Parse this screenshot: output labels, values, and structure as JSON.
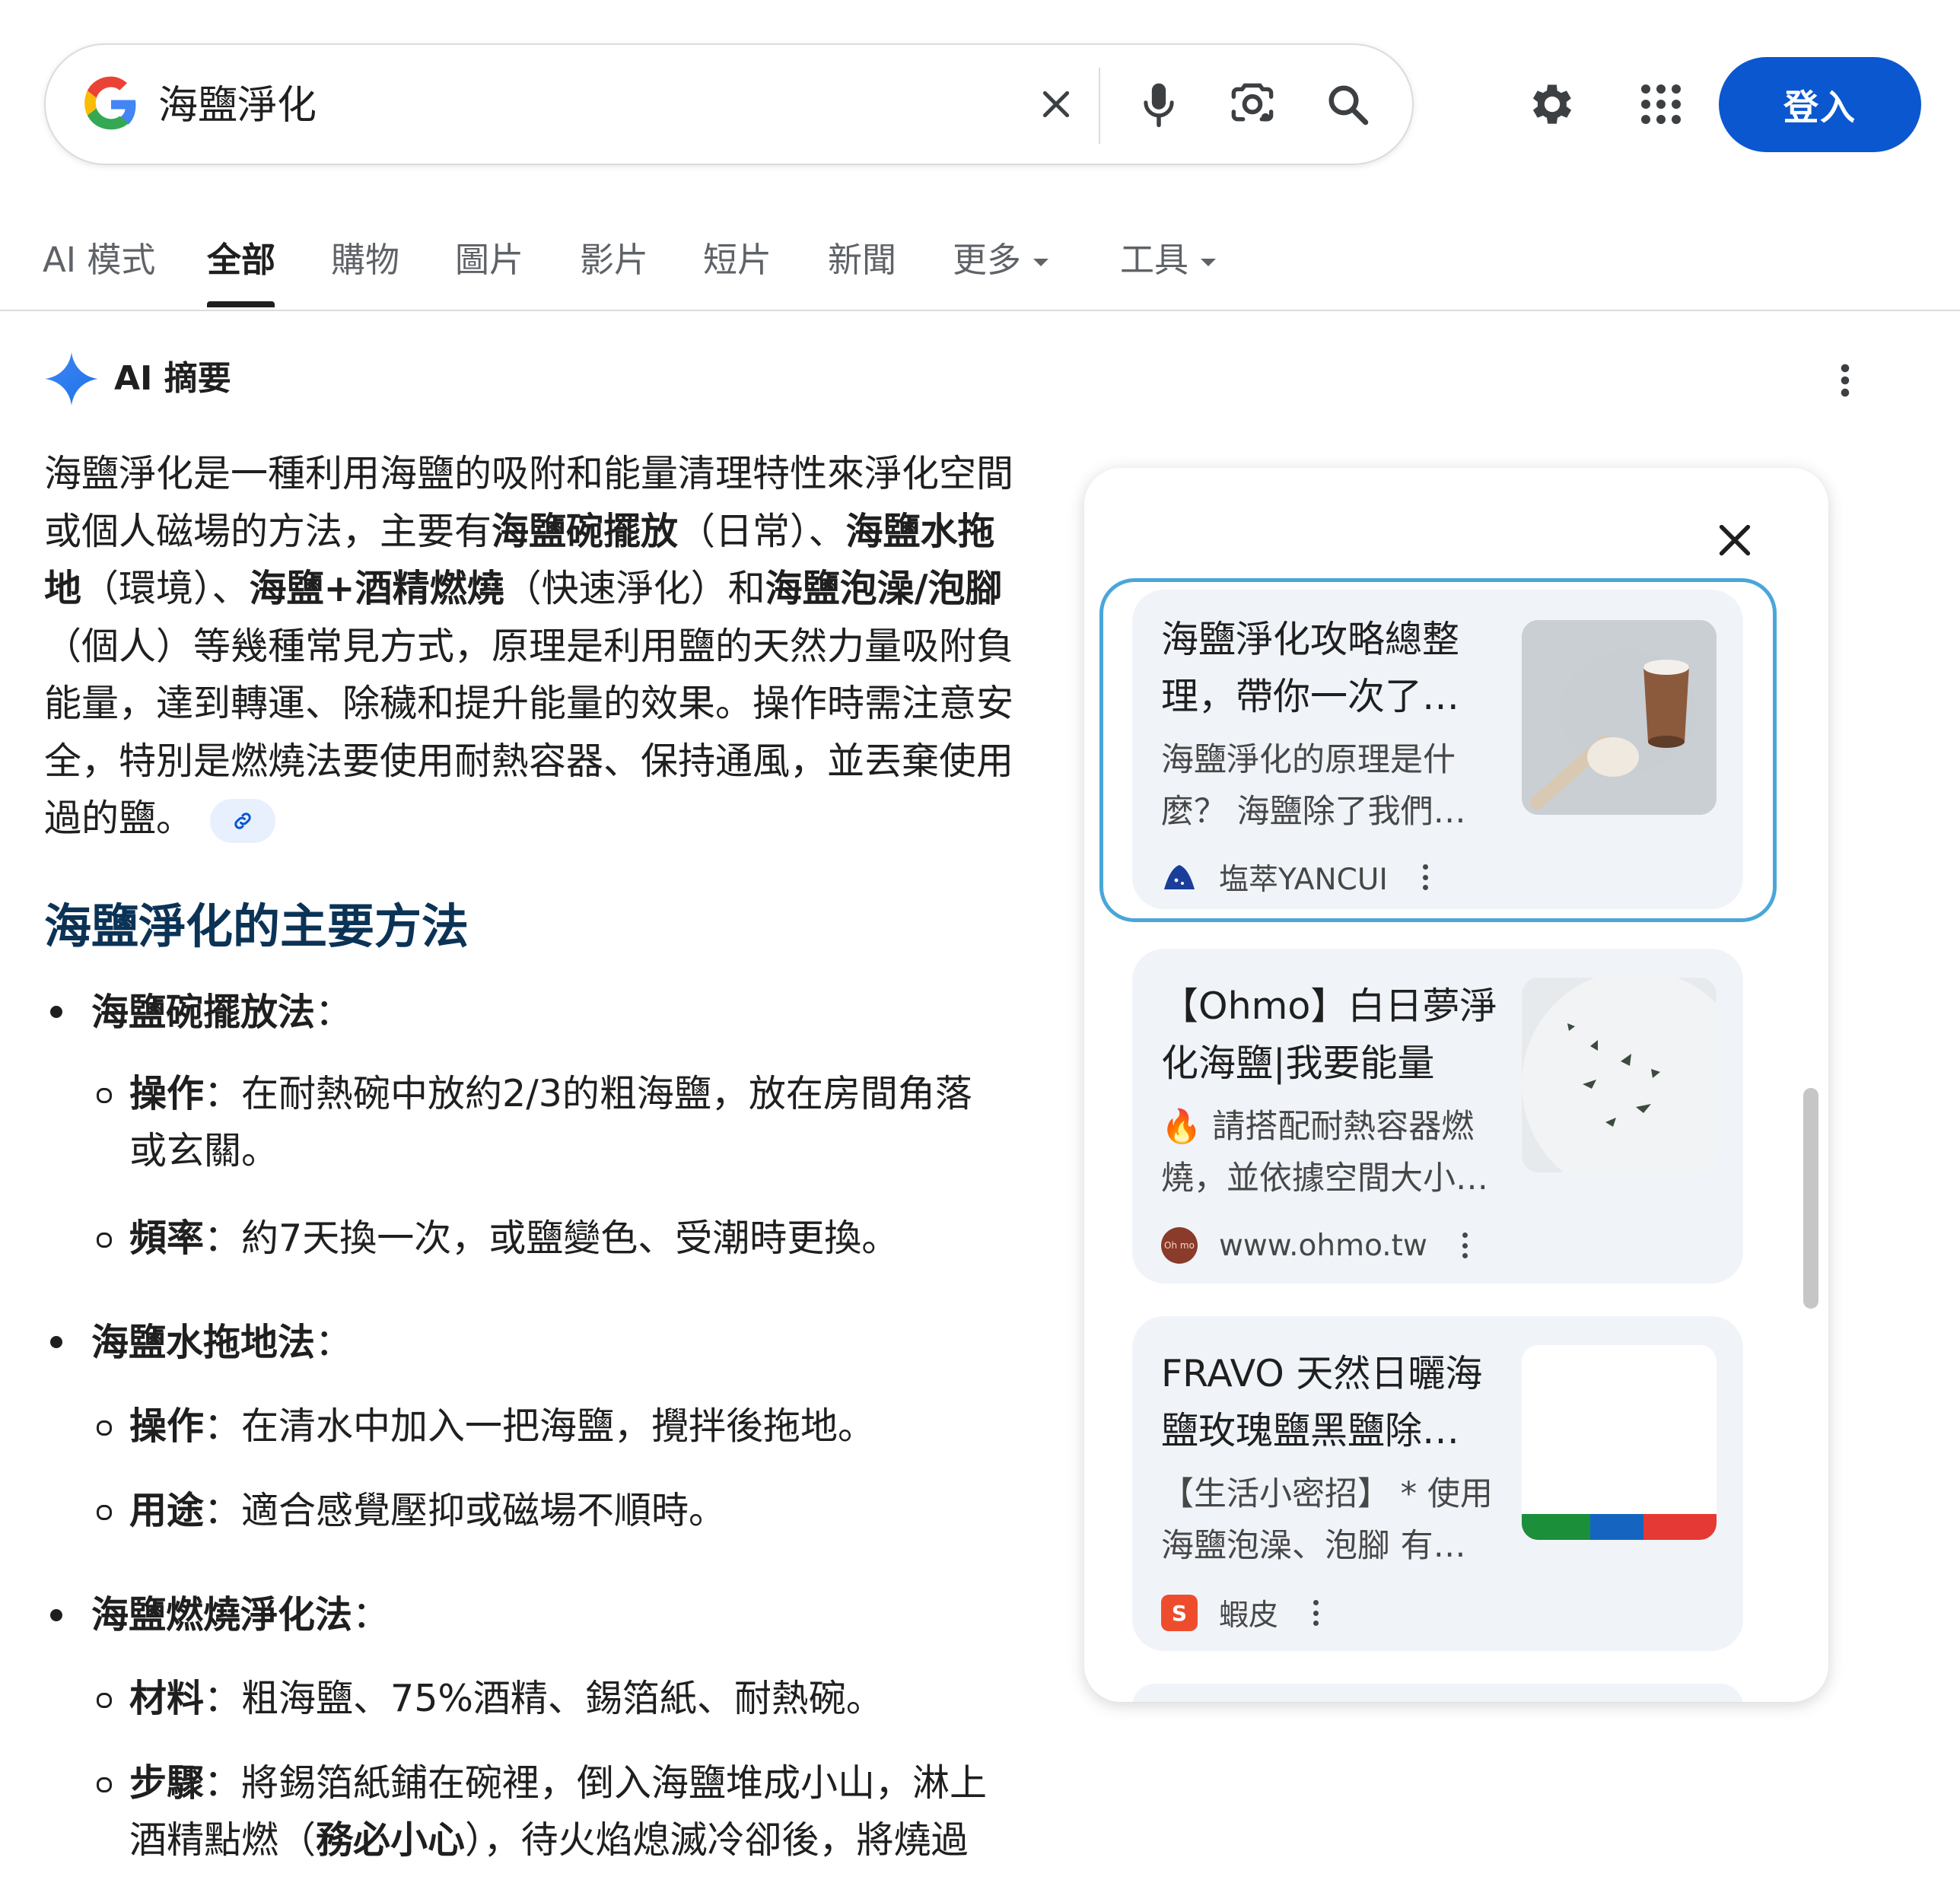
{
  "search": {
    "query": "海鹽淨化"
  },
  "header": {
    "signin_label": "登入"
  },
  "tabs": [
    {
      "label": "AI 模式"
    },
    {
      "label": "全部"
    },
    {
      "label": "購物"
    },
    {
      "label": "圖片"
    },
    {
      "label": "影片"
    },
    {
      "label": "短片"
    },
    {
      "label": "新聞"
    },
    {
      "label": "更多"
    },
    {
      "label": "工具"
    }
  ],
  "ai_overview": {
    "label": "AI 摘要",
    "summary": {
      "p1": "海鹽淨化是一種利用海鹽的吸附和能量清理特性來淨化空間或個人磁場的方法，主要有",
      "b1": "海鹽碗擺放",
      "p2": "（日常）、",
      "b2": "海鹽水拖地",
      "p3": "（環境）、",
      "b3": "海鹽+酒精燃燒",
      "p4": "（快速淨化）和",
      "b4": "海鹽泡澡/泡腳",
      "p5": "（個人）等幾種常見方式，原理是利用鹽的天然力量吸附負能量，達到轉運、除穢和提升能量的效果。操作時需注意安全，特別是燃燒法要使用耐熱容器、保持通風，並丟棄使用過的鹽。"
    },
    "section_heading": "海鹽淨化的主要方法",
    "methods": [
      {
        "title": "海鹽碗擺放法",
        "colon": "：",
        "items": [
          {
            "label": "操作",
            "text": "：在耐熱碗中放約2/3的粗海鹽，放在房間角落或玄關。"
          },
          {
            "label": "頻率",
            "text": "：約7天換一次，或鹽變色、受潮時更換。"
          }
        ]
      },
      {
        "title": "海鹽水拖地法",
        "colon": "：",
        "items": [
          {
            "label": "操作",
            "text": "：在清水中加入一把海鹽，攪拌後拖地。"
          },
          {
            "label": "用途",
            "text": "：適合感覺壓抑或磁場不順時。"
          }
        ]
      },
      {
        "title": "海鹽燃燒淨化法",
        "colon": "：",
        "items": [
          {
            "label": "材料",
            "text": "：粗海鹽、75%酒精、錫箔紙、耐熱碗。"
          },
          {
            "label": "步驟",
            "text_a": "：將錫箔紙鋪在碗裡，倒入海鹽堆成小山，淋上酒精點燃（",
            "bold": "務必小心",
            "text_b": "），待火焰熄滅冷卻後，將燒過"
          }
        ]
      }
    ]
  },
  "sources": [
    {
      "title": "海鹽淨化攻略總整理，帶你一次了…",
      "snippet": "海鹽淨化的原理是什麼？ 海鹽除了我們…",
      "site": "塩萃YANCUI",
      "thumb_icon": "salt-cup-image"
    },
    {
      "title": "【Ohmo】白日夢淨化海鹽|我要能量",
      "snippet": "🔥 請搭配耐熱容器燃燒，並依據空間大小…",
      "site": "www.ohmo.tw",
      "favicon_text": "Oh mo",
      "thumb_icon": "salt-herbs-image"
    },
    {
      "title": "FRAVO 天然日曬海鹽玫瑰鹽黑鹽除…",
      "snippet": "【生活小密招】 * 使用海鹽泡澡、泡腳 有…",
      "site": "蝦皮",
      "favicon_text": "S",
      "thumb_icon": "shopee-banner-image"
    }
  ],
  "colors": {
    "brand_blue": "#0b57d0",
    "heading_navy": "#0b3356",
    "card_bg": "#f0f4f9",
    "highlight_border": "#4aa6d9"
  }
}
